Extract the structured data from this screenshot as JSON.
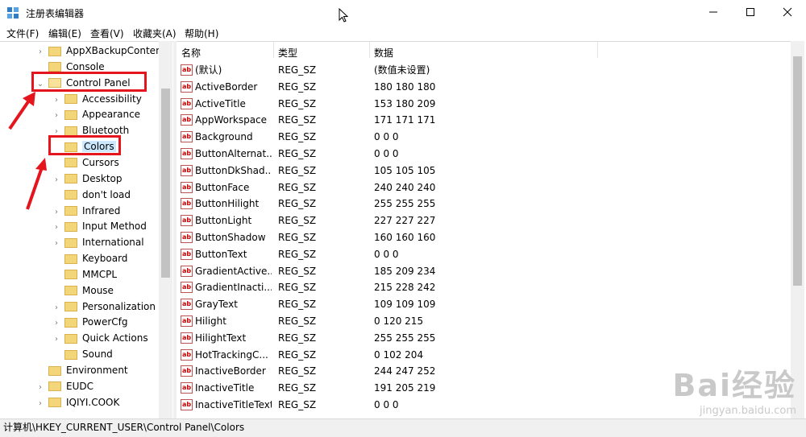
{
  "window": {
    "title": "注册表编辑器"
  },
  "menu": [
    "文件(F)",
    "编辑(E)",
    "查看(V)",
    "收藏夹(A)",
    "帮助(H)"
  ],
  "tree": {
    "items": [
      {
        "label": "AppXBackupContent",
        "indent": 1,
        "expander": "right",
        "open": false
      },
      {
        "label": "Console",
        "indent": 1,
        "expander": "none",
        "open": false
      },
      {
        "label": "Control Panel",
        "indent": 1,
        "expander": "down",
        "open": true,
        "highlighted": true
      },
      {
        "label": "Accessibility",
        "indent": 2,
        "expander": "right",
        "open": false
      },
      {
        "label": "Appearance",
        "indent": 2,
        "expander": "right",
        "open": false
      },
      {
        "label": "Bluetooth",
        "indent": 2,
        "expander": "right",
        "open": false
      },
      {
        "label": "Colors",
        "indent": 2,
        "expander": "none",
        "open": false,
        "selected": true,
        "highlighted": true
      },
      {
        "label": "Cursors",
        "indent": 2,
        "expander": "none",
        "open": false
      },
      {
        "label": "Desktop",
        "indent": 2,
        "expander": "right",
        "open": false
      },
      {
        "label": "don't load",
        "indent": 2,
        "expander": "none",
        "open": false
      },
      {
        "label": "Infrared",
        "indent": 2,
        "expander": "right",
        "open": false
      },
      {
        "label": "Input Method",
        "indent": 2,
        "expander": "right",
        "open": false
      },
      {
        "label": "International",
        "indent": 2,
        "expander": "right",
        "open": false
      },
      {
        "label": "Keyboard",
        "indent": 2,
        "expander": "none",
        "open": false
      },
      {
        "label": "MMCPL",
        "indent": 2,
        "expander": "none",
        "open": false
      },
      {
        "label": "Mouse",
        "indent": 2,
        "expander": "none",
        "open": false
      },
      {
        "label": "Personalization",
        "indent": 2,
        "expander": "right",
        "open": false
      },
      {
        "label": "PowerCfg",
        "indent": 2,
        "expander": "right",
        "open": false
      },
      {
        "label": "Quick Actions",
        "indent": 2,
        "expander": "right",
        "open": false
      },
      {
        "label": "Sound",
        "indent": 2,
        "expander": "none",
        "open": false
      },
      {
        "label": "Environment",
        "indent": 1,
        "expander": "none",
        "open": false
      },
      {
        "label": "EUDC",
        "indent": 1,
        "expander": "right",
        "open": false
      },
      {
        "label": "IQIYI.COOK",
        "indent": 1,
        "expander": "right",
        "open": false
      }
    ]
  },
  "list": {
    "columns": [
      "名称",
      "类型",
      "数据"
    ],
    "rows": [
      {
        "name": "(默认)",
        "type": "REG_SZ",
        "data": "(数值未设置)"
      },
      {
        "name": "ActiveBorder",
        "type": "REG_SZ",
        "data": "180 180 180"
      },
      {
        "name": "ActiveTitle",
        "type": "REG_SZ",
        "data": "153 180 209"
      },
      {
        "name": "AppWorkspace",
        "type": "REG_SZ",
        "data": "171 171 171"
      },
      {
        "name": "Background",
        "type": "REG_SZ",
        "data": "0 0 0"
      },
      {
        "name": "ButtonAlternat...",
        "type": "REG_SZ",
        "data": "0 0 0"
      },
      {
        "name": "ButtonDkShad...",
        "type": "REG_SZ",
        "data": "105 105 105"
      },
      {
        "name": "ButtonFace",
        "type": "REG_SZ",
        "data": "240 240 240"
      },
      {
        "name": "ButtonHilight",
        "type": "REG_SZ",
        "data": "255 255 255"
      },
      {
        "name": "ButtonLight",
        "type": "REG_SZ",
        "data": "227 227 227"
      },
      {
        "name": "ButtonShadow",
        "type": "REG_SZ",
        "data": "160 160 160"
      },
      {
        "name": "ButtonText",
        "type": "REG_SZ",
        "data": "0 0 0"
      },
      {
        "name": "GradientActive...",
        "type": "REG_SZ",
        "data": "185 209 234"
      },
      {
        "name": "GradientInacti...",
        "type": "REG_SZ",
        "data": "215 228 242"
      },
      {
        "name": "GrayText",
        "type": "REG_SZ",
        "data": "109 109 109"
      },
      {
        "name": "Hilight",
        "type": "REG_SZ",
        "data": "0 120 215"
      },
      {
        "name": "HilightText",
        "type": "REG_SZ",
        "data": "255 255 255"
      },
      {
        "name": "HotTrackingC...",
        "type": "REG_SZ",
        "data": "0 102 204"
      },
      {
        "name": "InactiveBorder",
        "type": "REG_SZ",
        "data": "244 247 252"
      },
      {
        "name": "InactiveTitle",
        "type": "REG_SZ",
        "data": "191 205 219"
      },
      {
        "name": "InactiveTitleText",
        "type": "REG_SZ",
        "data": "0 0 0"
      }
    ]
  },
  "status": {
    "path": "计算机\\HKEY_CURRENT_USER\\Control Panel\\Colors"
  },
  "icons": {
    "value": "ab"
  },
  "watermark": {
    "brand": "Bai经验",
    "site": "jingyan.baidu.com"
  },
  "colors": {
    "annotation": "#e4151d",
    "folder": "#f3d57a",
    "selection": "#cce8ff"
  }
}
